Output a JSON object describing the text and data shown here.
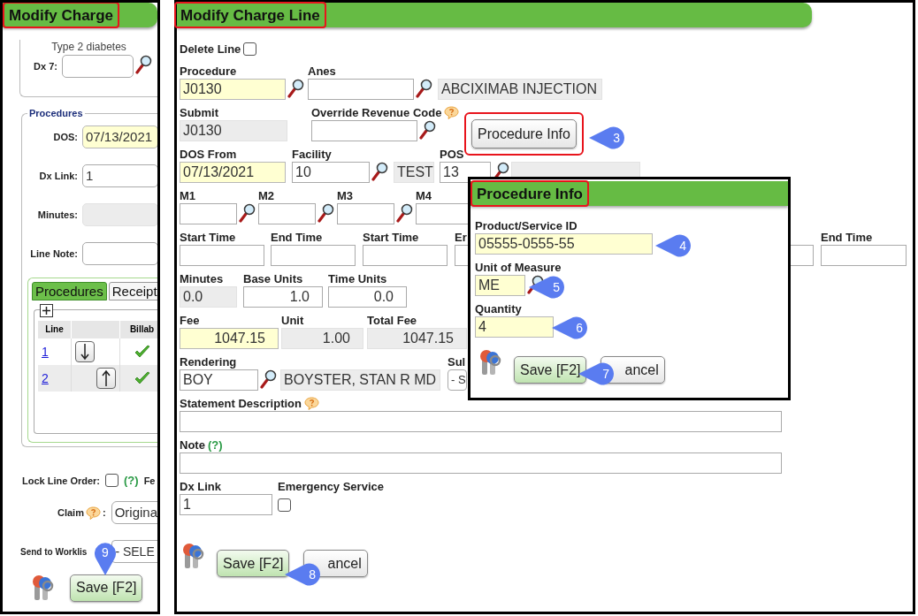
{
  "left_panel": {
    "title": "Modify Charge",
    "diagnosis_note": "Type 2 diabetes",
    "dx_field": {
      "label": "Dx 7:",
      "kind": "lookup"
    },
    "procedures": {
      "legend": "Procedures",
      "fields": [
        {
          "label": "DOS:",
          "value": "07/13/2021",
          "kind": "required"
        },
        {
          "label": "Dx Link:",
          "value": "1",
          "kind": "plain"
        },
        {
          "label": "Minutes:",
          "kind": "readonly"
        },
        {
          "label": "Line Note:",
          "kind": "plain"
        }
      ],
      "tabs": [
        {
          "label": "Procedures",
          "selected": true
        },
        {
          "label": "Receipt",
          "selected": false
        }
      ],
      "table": {
        "columns": [
          {
            "kind": "text",
            "label": "Line"
          },
          {
            "kind": "move"
          },
          {
            "kind": "text",
            "label": "Billab"
          }
        ],
        "rows": [
          {
            "line": "1",
            "kind": "down",
            "billable": true
          },
          {
            "line": "2",
            "kind": "up",
            "billable": true
          }
        ]
      }
    },
    "lock_line_order": {
      "label": "Lock Line Order:",
      "checked": false,
      "help": "(?)",
      "next_label": "Fe"
    },
    "claim": {
      "label": "Claim",
      "suffix": ":",
      "value": "Origina"
    },
    "worklist": {
      "label": "Send to Worklis",
      "value": "- SELE"
    },
    "save_button": "Save [F2]"
  },
  "main_panel": {
    "title": "Modify Charge Line",
    "delete_line": {
      "label": "Delete Line",
      "checked": false
    },
    "procedure": {
      "label": "Procedure",
      "value": "J0130",
      "kind": "required_lookup"
    },
    "anes": {
      "label": "Anes",
      "kind": "lookup"
    },
    "procedure_description": {
      "value": "ABCIXIMAB INJECTION",
      "kind": "readonly"
    },
    "submit": {
      "label": "Submit",
      "value": "J0130",
      "kind": "readonly"
    },
    "override_revenue_code": {
      "label": "Override Revenue Code",
      "kind": "lookup"
    },
    "procedure_info_button": "Procedure Info",
    "dos_from": {
      "label": "DOS From",
      "value": "07/13/2021",
      "kind": "required"
    },
    "facility": {
      "label": "Facility",
      "value": "10",
      "kind": "lookup"
    },
    "facility_name": {
      "value": "TEST",
      "kind": "readonly"
    },
    "pos": {
      "label": "POS",
      "value": "13",
      "kind": "lookup"
    },
    "pos_description": {
      "kind": "readonly"
    },
    "modifiers": [
      {
        "label": "M1",
        "kind": "lookup"
      },
      {
        "label": "M2",
        "kind": "lookup"
      },
      {
        "label": "M3",
        "kind": "lookup"
      },
      {
        "label": "M4",
        "kind": "plain"
      }
    ],
    "times": [
      {
        "label": "Start Time",
        "kind": "plain"
      },
      {
        "label": "End Time",
        "kind": "plain"
      },
      {
        "label": "Start Time",
        "kind": "plain"
      },
      {
        "label": "Er",
        "kind": "plain"
      },
      {
        "kind": "plain"
      },
      {
        "label": "End Time",
        "kind": "plain"
      }
    ],
    "units": [
      {
        "label": "Minutes",
        "value": "0.0",
        "kind": "readonly"
      },
      {
        "label": "Base Units",
        "value": "1.0",
        "kind": "plain"
      },
      {
        "label": "Time Units",
        "value": "0.0",
        "kind": "plain"
      }
    ],
    "fees": [
      {
        "label": "Fee",
        "value": "1047.15",
        "kind": "required"
      },
      {
        "label": "Unit",
        "value": "1.00",
        "kind": "readonly"
      },
      {
        "label": "Total Fee",
        "value": "1047.15",
        "kind": "readonly"
      }
    ],
    "rendering": {
      "label": "Rendering",
      "value": "BOY",
      "kind": "lookup"
    },
    "rendering_name": {
      "value": "BOYSTER, STAN R MD",
      "kind": "readonly"
    },
    "supervising": {
      "label": "Sul",
      "value": "- S",
      "kind": "select"
    },
    "statement_description": {
      "label": "Statement Description",
      "kind": "plain"
    },
    "note": {
      "label": "Note",
      "help": "(?)",
      "kind": "plain"
    },
    "dx_link": {
      "label": "Dx Link",
      "value": "1",
      "kind": "plain"
    },
    "emergency_service": {
      "label": "Emergency Service",
      "checked": false
    },
    "buttons": [
      {
        "label": "Save [F2]",
        "kind": "primary"
      },
      {
        "label": "ancel",
        "kind": "secondary"
      }
    ]
  },
  "popup": {
    "title": "Procedure Info",
    "fields": [
      {
        "label": "Product/Service ID",
        "value": "05555-0555-55",
        "kind": "required"
      },
      {
        "label": "Unit of Measure",
        "value": "ME",
        "kind": "required_lookup"
      },
      {
        "label": "Quantity",
        "value": "4",
        "kind": "required"
      }
    ],
    "buttons": [
      {
        "label": "Save [F2]",
        "kind": "primary"
      },
      {
        "label": "ancel",
        "kind": "secondary"
      }
    ]
  },
  "markers": [
    {
      "number": "3",
      "kind": "left"
    },
    {
      "number": "4",
      "kind": "left"
    },
    {
      "number": "5",
      "kind": "left"
    },
    {
      "number": "6",
      "kind": "left"
    },
    {
      "number": "7",
      "kind": "left"
    },
    {
      "number": "8",
      "kind": "left"
    },
    {
      "number": "9",
      "kind": "down"
    }
  ]
}
